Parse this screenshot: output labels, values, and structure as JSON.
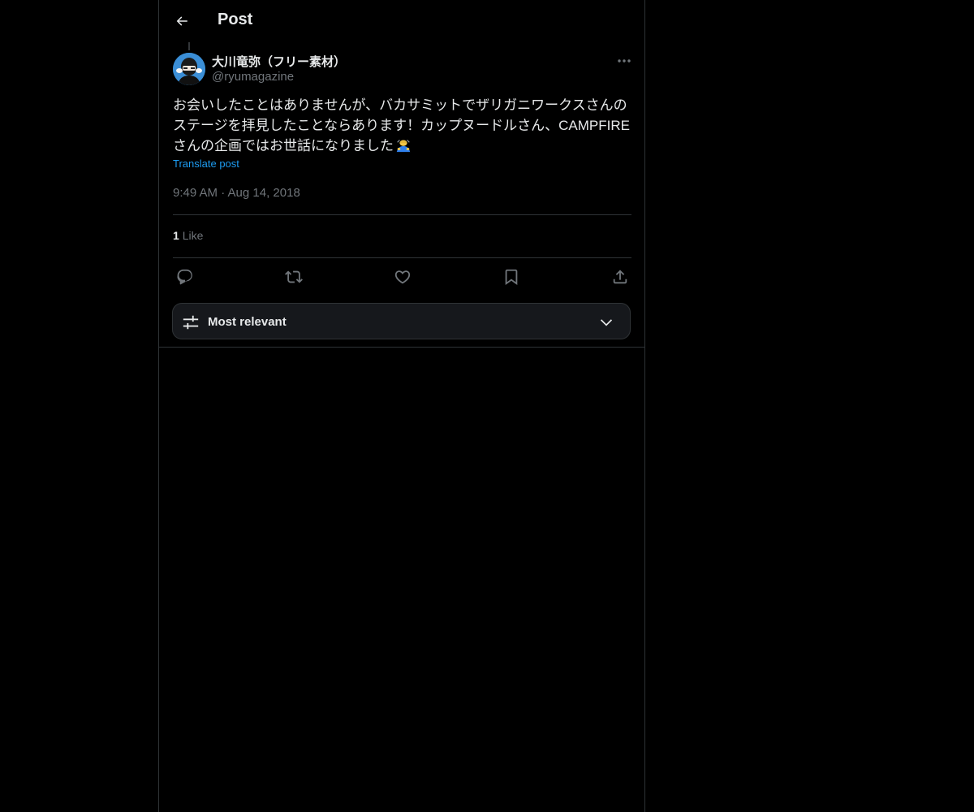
{
  "header": {
    "title": "Post",
    "back_icon": "arrow-left-icon"
  },
  "post": {
    "author_name": "大川竜弥（フリー素材）",
    "author_handle": "@ryumagazine",
    "text": "お会いしたことはありませんが、バカサミットでザリガニワークスさんのステージを拝見したことならあります！カップヌードルさん、CAMPFIREさんの企画ではお世話になりました",
    "emoji": "bowing-person-emoji",
    "translate_label": "Translate post",
    "timestamp": "9:49 AM · Aug 14, 2018",
    "likes_count": "1",
    "likes_label": "Like"
  },
  "actions": {
    "reply_icon": "reply-icon",
    "repost_icon": "repost-icon",
    "like_icon": "heart-icon",
    "bookmark_icon": "bookmark-icon",
    "share_icon": "share-icon"
  },
  "sort": {
    "label": "Most relevant"
  },
  "colors": {
    "background": "#000000",
    "text": "#e7e9ea",
    "muted": "#71767b",
    "accent": "#1d9bf0",
    "border": "#2f3336"
  }
}
